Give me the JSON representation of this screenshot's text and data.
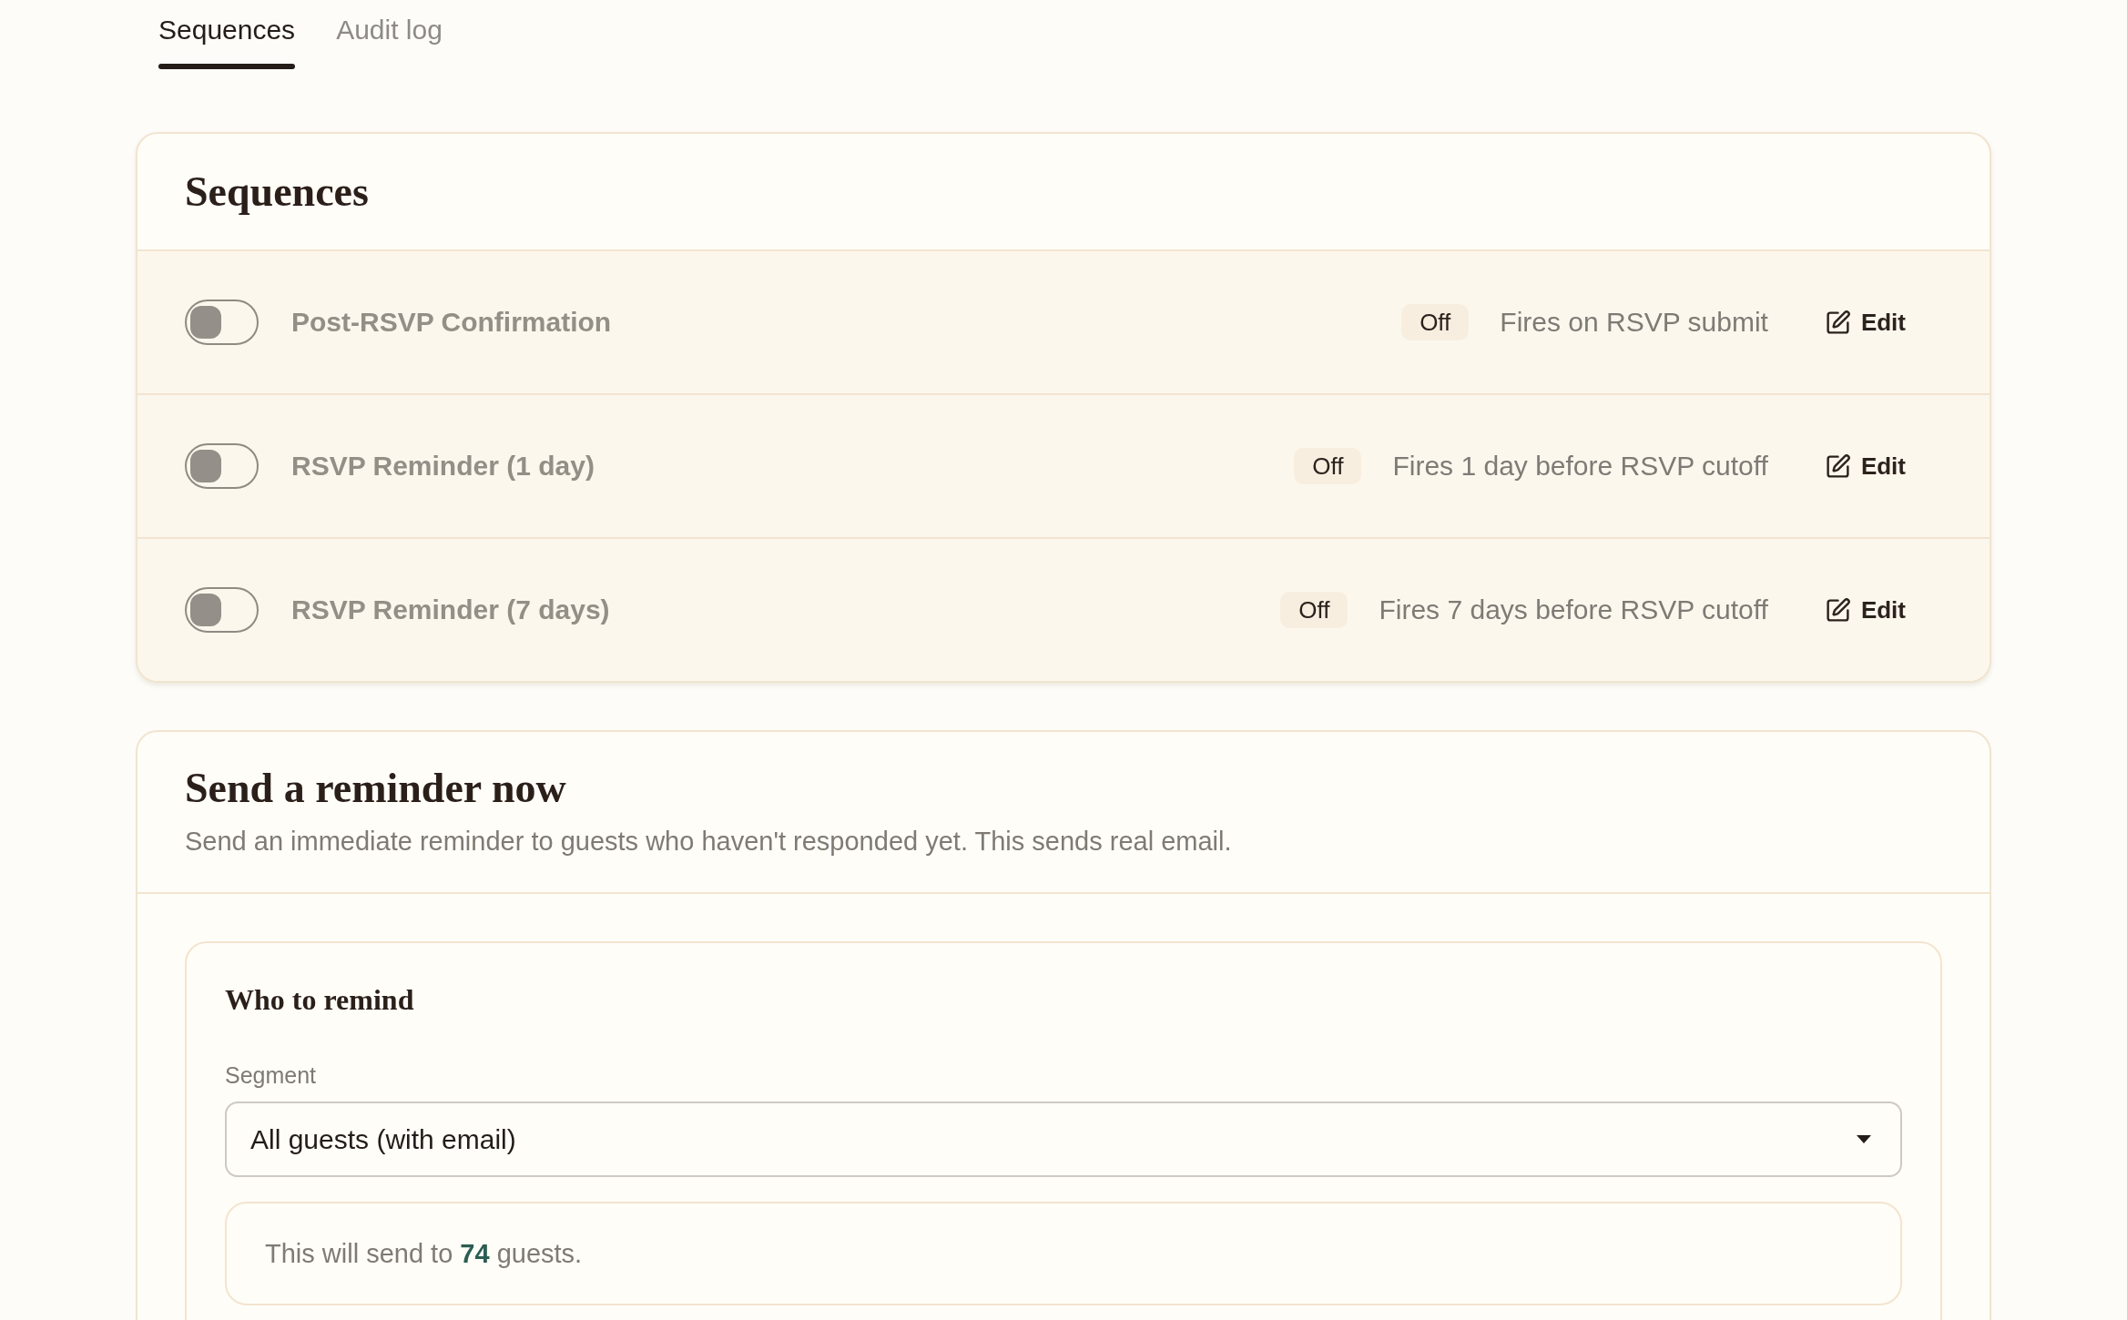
{
  "tabs": [
    {
      "label": "Sequences",
      "selected": true
    },
    {
      "label": "Audit log",
      "selected": false
    }
  ],
  "sequences_card": {
    "title": "Sequences",
    "sequences": [
      {
        "name": "Post-RSVP Confirmation",
        "on": false,
        "status": "Off",
        "trigger": "Fires on RSVP submit",
        "action": "Edit"
      },
      {
        "name": "RSVP Reminder (1 day)",
        "on": false,
        "status": "Off",
        "trigger": "Fires 1 day before RSVP cutoff",
        "action": "Edit"
      },
      {
        "name": "RSVP Reminder (7 days)",
        "on": false,
        "status": "Off",
        "trigger": "Fires 7 days before RSVP cutoff",
        "action": "Edit"
      }
    ]
  },
  "reminder_card": {
    "title": "Send a reminder now",
    "description": "Send an immediate reminder to guests who haven't responded yet. This sends real email.",
    "audience": {
      "title": "Who to remind",
      "segment": {
        "label": "Segment",
        "value": "All guests (with email)"
      },
      "estimate": "This will send to **74** guests."
    }
  }
}
